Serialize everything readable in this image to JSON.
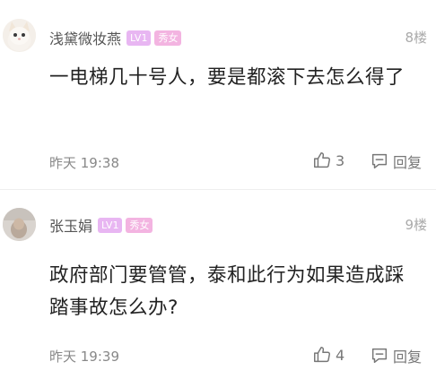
{
  "comments": [
    {
      "username": "浅黛微妆燕",
      "level_badge": "LV1",
      "tag_badge": "秀女",
      "floor": "8楼",
      "content": "一电梯几十号人，要是都滚下去怎么得了",
      "time": "昨天 19:38",
      "likes": "3",
      "reply_label": "回复",
      "avatar_icon": "cat-avatar"
    },
    {
      "username": "张玉娟",
      "level_badge": "LV1",
      "tag_badge": "秀女",
      "floor": "9楼",
      "content": "政府部门要管管，泰和此行为如果造成踩踏事故怎么办?",
      "time": "昨天 19:39",
      "likes": "4",
      "reply_label": "回复",
      "avatar_icon": "photo-avatar"
    }
  ],
  "colors": {
    "level_badge": "#e8b6f2",
    "tag_badge": "#f3b4e1",
    "text": "#222222",
    "meta": "#888888"
  }
}
